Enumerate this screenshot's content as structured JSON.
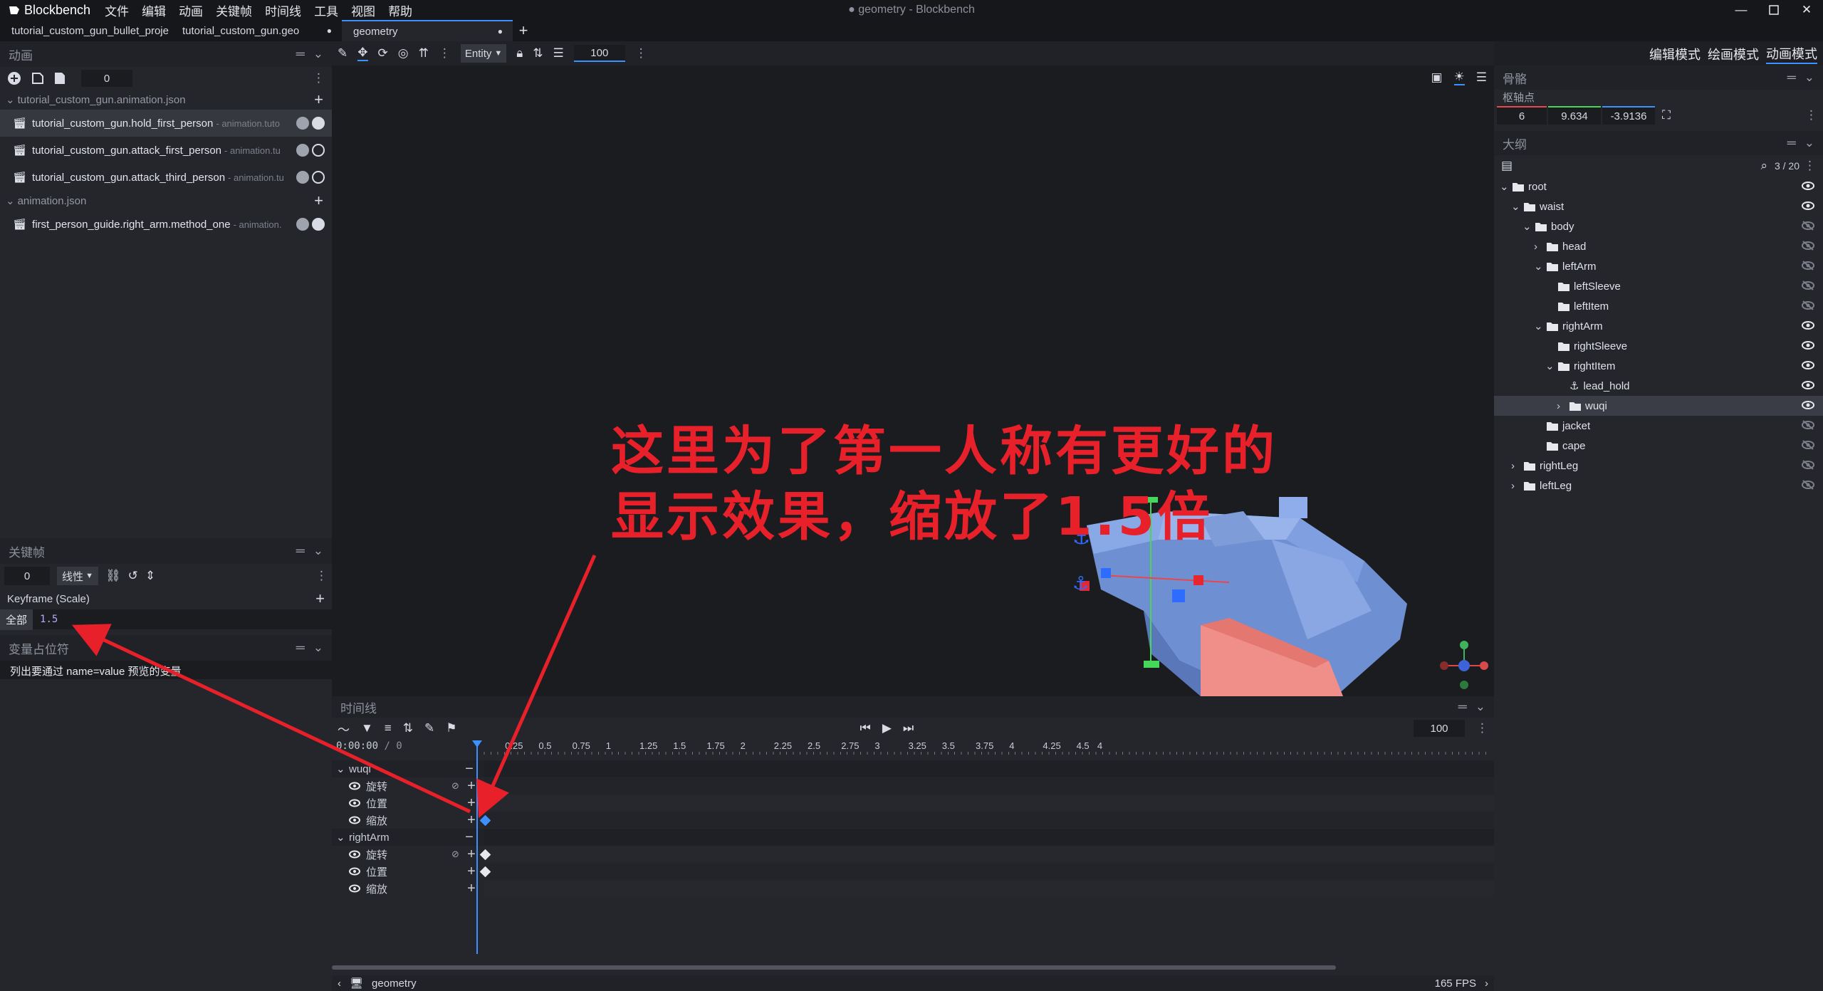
{
  "app": {
    "name": "Blockbench",
    "window_title": "● geometry - Blockbench",
    "menu": [
      "文件",
      "编辑",
      "动画",
      "关键帧",
      "时间线",
      "工具",
      "视图",
      "帮助"
    ]
  },
  "tabs": [
    {
      "label": "tutorial_custom_gun_bullet_projе"
    },
    {
      "label": "tutorial_custom_gun.geo"
    },
    {
      "label": "geometry",
      "active": true
    }
  ],
  "modes": [
    "编辑模式",
    "绘画模式",
    "动画模式"
  ],
  "toolbar": {
    "entity_label": "Entity",
    "value": "100"
  },
  "animations_panel": {
    "title": "动画",
    "counter": "0",
    "groups": [
      {
        "file": "tutorial_custom_gun.animation.json",
        "items": [
          {
            "name": "tutorial_custom_gun.hold_first_person",
            "file": " - animation.tuto"
          },
          {
            "name": "tutorial_custom_gun.attack_first_person",
            "file": " - animation.tu"
          },
          {
            "name": "tutorial_custom_gun.attack_third_person",
            "file": " - animation.tu"
          }
        ]
      },
      {
        "file": "animation.json",
        "items": [
          {
            "name": "first_person_guide.right_arm.method_one",
            "file": " - animation."
          }
        ]
      }
    ]
  },
  "keyframe_panel": {
    "title": "关键帧",
    "time": "0",
    "interpolation": "线性",
    "channel_title": "Keyframe (Scale)",
    "axis_label": "全部",
    "axis_value": "1.5"
  },
  "variable_panel": {
    "title": "变量占位符",
    "hint": "列出要通过 name=value 预览的变量"
  },
  "bone_panel": {
    "title": "骨骼",
    "pivot_label": "枢轴点",
    "pivot": [
      "6",
      "9.634",
      "-3.9136"
    ]
  },
  "outliner": {
    "title": "大纲",
    "count": "3 / 20",
    "nodes": [
      {
        "label": "root",
        "depth": 0,
        "arrow": "down",
        "visible": true
      },
      {
        "label": "waist",
        "depth": 1,
        "arrow": "down",
        "visible": true
      },
      {
        "label": "body",
        "depth": 2,
        "arrow": "down",
        "visible": false
      },
      {
        "label": "head",
        "depth": 3,
        "arrow": "right",
        "visible": false
      },
      {
        "label": "leftArm",
        "depth": 3,
        "arrow": "down",
        "visible": false
      },
      {
        "label": "leftSleeve",
        "depth": 4,
        "arrow": "",
        "visible": false
      },
      {
        "label": "leftItem",
        "depth": 4,
        "arrow": "",
        "visible": false
      },
      {
        "label": "rightArm",
        "depth": 3,
        "arrow": "down",
        "visible": true
      },
      {
        "label": "rightSleeve",
        "depth": 4,
        "arrow": "",
        "visible": true
      },
      {
        "label": "rightItem",
        "depth": 4,
        "arrow": "down",
        "visible": true
      },
      {
        "label": "lead_hold",
        "depth": 5,
        "arrow": "",
        "visible": true,
        "locator": true
      },
      {
        "label": "wuqi",
        "depth": 5,
        "arrow": "right",
        "visible": true,
        "selected": true
      },
      {
        "label": "jacket",
        "depth": 3,
        "arrow": "",
        "visible": false
      },
      {
        "label": "cape",
        "depth": 3,
        "arrow": "",
        "visible": false
      },
      {
        "label": "rightLeg",
        "depth": 1,
        "arrow": "right",
        "visible": false
      },
      {
        "label": "leftLeg",
        "depth": 1,
        "arrow": "right",
        "visible": false
      }
    ]
  },
  "annotation": {
    "line1": "这里为了第一人称有更好的",
    "line2": "显示效果，缩放了1.5倍"
  },
  "timeline": {
    "title": "时间线",
    "timecode": "0:00:00",
    "frame": "/ 0",
    "length_value": "100",
    "ticks": [
      "0.25",
      "0.5",
      "0.75",
      "1",
      "1.25",
      "1.5",
      "1.75",
      "2",
      "2.25",
      "2.5",
      "2.75",
      "3",
      "3.25",
      "3.5",
      "3.75",
      "4",
      "4.25",
      "4.5",
      "4"
    ],
    "bones": [
      {
        "name": "wuqi",
        "channels": [
          "旋转",
          "位置",
          "缩放"
        ]
      },
      {
        "name": "rightArm",
        "channels": [
          "旋转",
          "位置",
          "缩放"
        ]
      }
    ]
  },
  "status": {
    "project": "geometry",
    "fps": "165 FPS"
  },
  "colors": {
    "accent": "#3e90ff",
    "annotation_red": "#e8202a",
    "selected_row": "#3a3d45"
  }
}
